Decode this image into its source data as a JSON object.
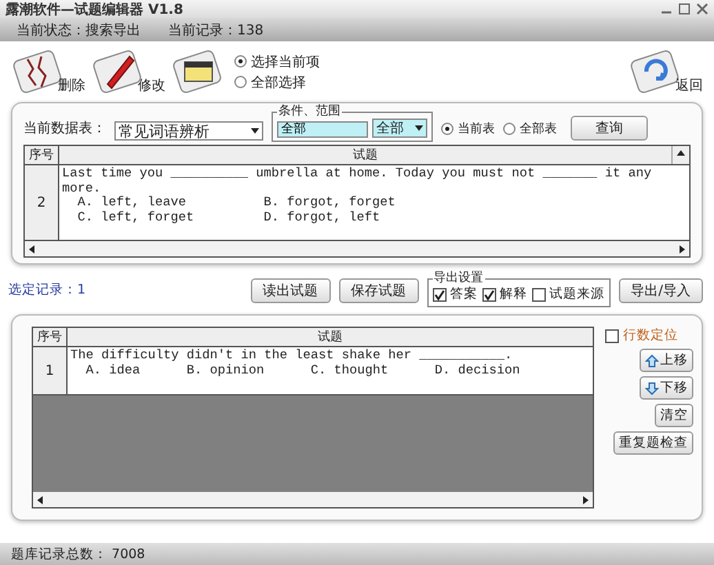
{
  "window": {
    "title": "露潮软件—试题编辑器 V1.8"
  },
  "status": {
    "state": "当前状态：搜索导出",
    "record": "当前记录：138"
  },
  "toolbar": {
    "buttons": [
      {
        "kind": "delete",
        "label": "删除"
      },
      {
        "kind": "edit",
        "label": "修改"
      },
      {
        "kind": "note"
      }
    ],
    "radios": [
      {
        "label": "选择当前项",
        "selected": true
      },
      {
        "label": "全部选择",
        "selected": false
      }
    ],
    "back": {
      "label": "返回"
    }
  },
  "search_panel": {
    "table_label": "当前数据表：",
    "table_select": "常见词语辨析",
    "condition_group": {
      "title": "条件、范围",
      "value": "全部",
      "range_select": "全部"
    },
    "scope_radios": [
      {
        "label": "当前表",
        "selected": true
      },
      {
        "label": "全部表",
        "selected": false
      }
    ],
    "query_button": "查询",
    "table": {
      "columns": [
        "序号",
        "试题"
      ],
      "rows": [
        {
          "number": "2",
          "lines": [
            "Last time you __________ umbrella at home. Today you must not _______ it any",
            "more.",
            "  A. left, leave          B. forgot, forget",
            "  C. left, forget         D. forgot, left"
          ]
        }
      ]
    }
  },
  "middle": {
    "selected_records": "选定记录：1",
    "buttons": [
      "读出试题",
      "保存试题"
    ],
    "export_group": {
      "title": "导出设置",
      "options": [
        {
          "label": "答案",
          "checked": true
        },
        {
          "label": "解释",
          "checked": true
        },
        {
          "label": "试题来源",
          "checked": false
        }
      ]
    },
    "export_button": "导出/导入"
  },
  "selection_panel": {
    "table": {
      "columns": [
        "序号",
        "试题"
      ],
      "rows": [
        {
          "number": "1",
          "lines": [
            "The difficulty didn't in the least shake her ___________.",
            "  A. idea      B. opinion      C. thought      D. decision"
          ]
        }
      ]
    },
    "row_locate": {
      "label": "行数定位",
      "checked": false
    },
    "buttons": [
      {
        "kind": "up",
        "label": "上移"
      },
      {
        "kind": "down",
        "label": "下移"
      },
      {
        "kind": "plain",
        "label": "清空"
      },
      {
        "kind": "plain",
        "label": "重复题检查"
      }
    ]
  },
  "status_bar": {
    "total": "题库记录总数： 7008"
  }
}
